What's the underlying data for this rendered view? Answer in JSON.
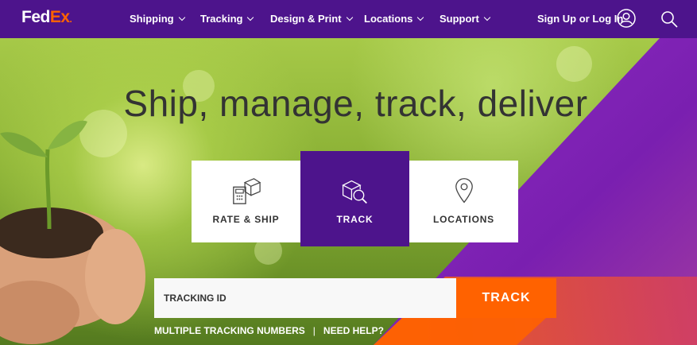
{
  "header": {
    "logo": {
      "part1": "Fed",
      "part2": "Ex",
      "suffix": "."
    },
    "nav": [
      {
        "label": "Shipping"
      },
      {
        "label": "Tracking"
      },
      {
        "label": "Design & Print"
      },
      {
        "label": "Locations"
      },
      {
        "label": "Support"
      }
    ],
    "signin_label": "Sign Up or Log In"
  },
  "hero": {
    "headline": "Ship, manage, track, deliver",
    "tabs": [
      {
        "label": "RATE & SHIP",
        "icon": "rate-ship-icon"
      },
      {
        "label": "TRACK",
        "icon": "track-package-icon",
        "active": true
      },
      {
        "label": "LOCATIONS",
        "icon": "location-pin-icon"
      }
    ],
    "tracking": {
      "placeholder": "TRACKING ID",
      "button_label": "TRACK"
    },
    "links": {
      "multiple": "MULTIPLE TRACKING NUMBERS",
      "separator": "|",
      "help": "NEED HELP?"
    }
  },
  "colors": {
    "brand_purple": "#4d148c",
    "brand_orange": "#ff6200",
    "headline_text": "#333333"
  }
}
